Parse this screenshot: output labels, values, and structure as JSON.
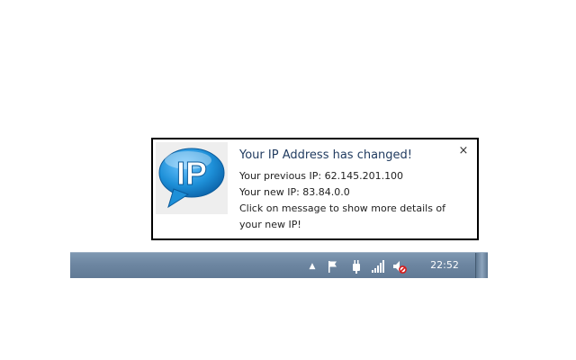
{
  "notification": {
    "title": "Your IP Address has changed!",
    "lines": [
      "Your previous IP: 62.145.201.100",
      "Your new IP: 83.84.0.0",
      "Click on message to show more details of",
      "your new IP!"
    ],
    "close_symbol": "×",
    "logo_text": "IP",
    "icon": "speech-bubble-ip-logo",
    "colors": {
      "logo_blue": "#1e90d8",
      "border": "#000000"
    }
  },
  "taskbar": {
    "tray_arrow_symbol": "▲",
    "tray_icons": [
      "action-center-flag-icon",
      "power-plug-icon",
      "network-signal-icon",
      "volume-muted-icon"
    ],
    "clock": "22:52",
    "colors": {
      "background": "#6d86a1",
      "text": "#ffffff"
    }
  }
}
